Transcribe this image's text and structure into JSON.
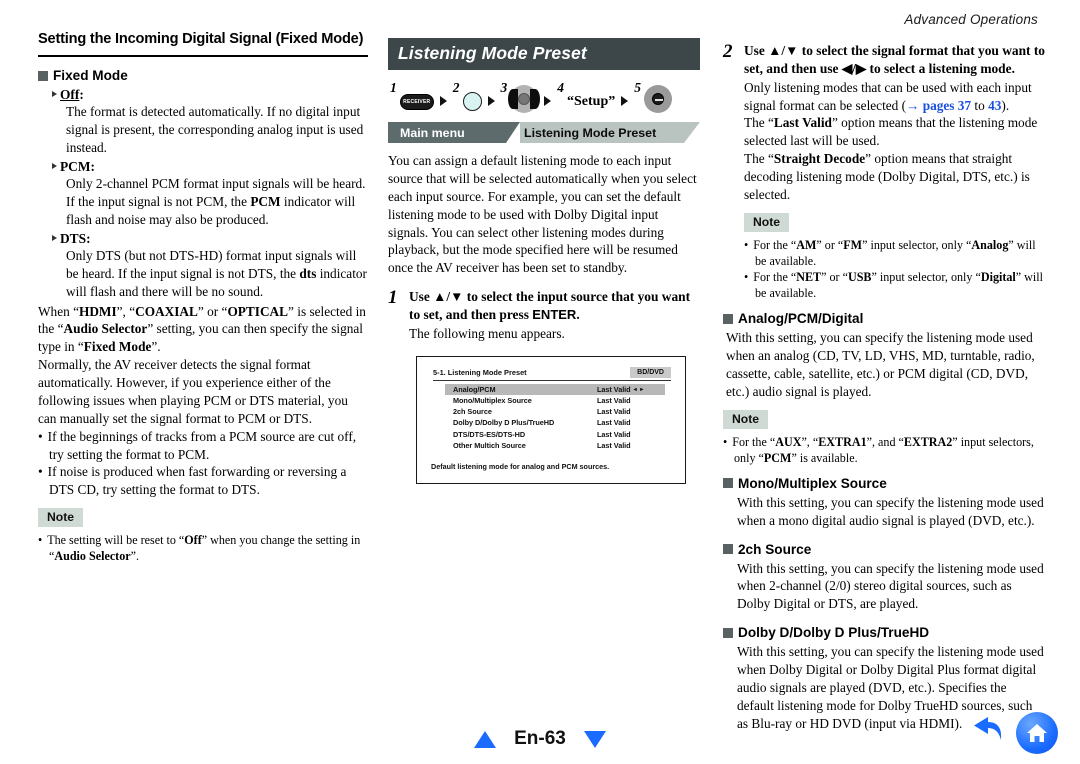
{
  "runhead": "Advanced Operations",
  "left": {
    "title": "Setting the Incoming Digital Signal (Fixed Mode)",
    "section_head": "Fixed Mode",
    "items": [
      {
        "term": "Off",
        "body": "The format is detected automatically. If no digital input signal is present, the corresponding analog input is used instead."
      },
      {
        "term": "PCM",
        "body_1": "Only 2-channel PCM format input signals will be heard. If the input signal is not PCM, the ",
        "body_bold": "PCM",
        "body_2": " indicator will flash and noise may also be produced."
      },
      {
        "term": "DTS",
        "body_1": "Only DTS (but not DTS-HD) format input signals will be heard. If the input signal is not DTS, the ",
        "body_bold": "dts",
        "body_2": " indicator will flash and there will be no sound."
      }
    ],
    "para_hdmi": {
      "p1": "When “",
      "b1": "HDMI",
      "p2": "”, “",
      "b2": "COAXIAL",
      "p3": "” or “",
      "b3": "OPTICAL",
      "p4": "” is selected in the “",
      "b4": "Audio Selector",
      "p5": "” setting, you can then specify the signal type in “",
      "b5": "Fixed Mode",
      "p6": "”."
    },
    "para_normally": "Normally, the AV receiver detects the signal format automatically. However, if you experience either of the following issues when playing PCM or DTS material, you can manually set the signal format to PCM or DTS.",
    "bullets": [
      "If the beginnings of tracks from a PCM source are cut off, try setting the format to PCM.",
      "If noise is produced when fast forwarding or reversing a DTS CD, try setting the format to DTS."
    ],
    "note_label": "Note",
    "note_bullet": {
      "p1": "The setting will be reset to “",
      "b1": "Off",
      "p2": "” when you change the setting in “",
      "b2": "Audio Selector",
      "p3": "”."
    }
  },
  "middle": {
    "title": "Listening Mode Preset",
    "steps": [
      {
        "num": "1",
        "icon": "receiver-button-icon",
        "label": "RECEIVER"
      },
      {
        "num": "2",
        "icon": "round-button-icon",
        "label": ""
      },
      {
        "num": "3",
        "icon": "dpad-left-right-icon",
        "label": ""
      },
      {
        "num": "4",
        "icon": "setup-word",
        "label": "“Setup”"
      },
      {
        "num": "5",
        "icon": "dpad-enter-icon",
        "label": ""
      }
    ],
    "breadcrumb": {
      "main": "Main menu",
      "sub": "Listening Mode Preset"
    },
    "intro": "You can assign a default listening mode to each input source that will be selected automatically when you select each input source. For example, you can set the default listening mode to be used with Dolby Digital input signals. You can select other listening modes during playback, but the mode specified here will be resumed once the AV receiver has been set to standby.",
    "step1": {
      "num": "1",
      "lead_1": "Use ▲/▼ to select the input source that you want to set, and then press ",
      "lead_enter": "ENTER",
      "lead_2": ".",
      "after": "The following menu appears."
    },
    "osd": {
      "title": "5-1. Listening Mode Preset",
      "badge": "BD/DVD",
      "rows": [
        {
          "label": "Analog/PCM",
          "value": "Last Valid",
          "arrows": "◂ ▸",
          "selected": true
        },
        {
          "label": "Mono/Multiplex Source",
          "value": "Last Valid",
          "arrows": "",
          "selected": false
        },
        {
          "label": "2ch Source",
          "value": "Last Valid",
          "arrows": "",
          "selected": false
        },
        {
          "label": "Dolby D/Dolby D Plus/TrueHD",
          "value": "Last Valid",
          "arrows": "",
          "selected": false
        },
        {
          "label": "DTS/DTS-ES/DTS-HD",
          "value": "Last Valid",
          "arrows": "",
          "selected": false
        },
        {
          "label": "Other Multich Source",
          "value": "Last Valid",
          "arrows": "",
          "selected": false
        }
      ],
      "footer": "Default listening mode for analog and PCM sources."
    }
  },
  "right": {
    "step2": {
      "num": "2",
      "lead": "Use ▲/▼ to select the signal format that you want to set, and then use ◀/▶ to select a listening mode.",
      "p1_a": "Only listening modes that can be used with each input signal format can be selected (",
      "p1_arrow": "→",
      "p1_link1": "pages 37",
      "p1_mid": " to ",
      "p1_link2": "43",
      "p1_b": ").",
      "p2_a": "The “",
      "p2_b": "Last Valid",
      "p2_c": "” option means that the listening mode selected last will be used.",
      "p3_a": "The “",
      "p3_b": "Straight Decode",
      "p3_c": "” option means that straight decoding listening mode (Dolby Digital, DTS, etc.) is selected."
    },
    "note1_label": "Note",
    "note1_bullets": [
      {
        "p1": "For the “",
        "b1": "AM",
        "p2": "” or “",
        "b2": "FM",
        "p3": "” input selector, only “",
        "b3": "Analog",
        "p4": "” will be available."
      },
      {
        "p1": "For the “",
        "b1": "NET",
        "p2": "” or “",
        "b2": "USB",
        "p3": "” input selector, only “",
        "b3": "Digital",
        "p4": "” will be available."
      }
    ],
    "sections": [
      {
        "head": "Analog/PCM/Digital",
        "body": "With this setting, you can specify the listening mode used when an analog (CD, TV, LD, VHS, MD, turntable, radio, cassette, cable, satellite, etc.) or PCM digital (CD, DVD, etc.) audio signal is played."
      },
      {
        "head": "Mono/Multiplex Source",
        "body": "With this setting, you can specify the listening mode used when a mono digital audio signal is played (DVD, etc.)."
      },
      {
        "head": "2ch Source",
        "body": "With this setting, you can specify the listening mode used when 2-channel (2/0) stereo digital sources, such as Dolby Digital or DTS, are played."
      },
      {
        "head": "Dolby D/Dolby D Plus/TrueHD",
        "body": "With this setting, you can specify the listening mode used when Dolby Digital or Dolby Digital Plus format digital audio signals are played (DVD, etc.). Specifies the default listening mode for Dolby TrueHD sources, such as Blu-ray or HD DVD (input via HDMI)."
      }
    ],
    "note2_label": "Note",
    "note2_bullet": {
      "p1": "For the “",
      "b1": "AUX",
      "p2": "”, “",
      "b2": "EXTRA1",
      "p3": "”, and “",
      "b3": "EXTRA2",
      "p4": "” input selectors, only “",
      "b4": "PCM",
      "p5": "” is available."
    }
  },
  "footer": {
    "page": "En-63",
    "up_icon": "triangle-up-icon",
    "down_icon": "triangle-down-icon",
    "back_icon": "back-arrow-icon",
    "home_icon": "home-icon"
  },
  "colors": {
    "accent_blue": "#1a6bff",
    "link_blue": "#1a4fe0",
    "title_bar": "#3d4749",
    "breadcrumb_main": "#5d6b6d",
    "breadcrumb_sub": "#b9c4c1",
    "note_bg": "#cfdad4",
    "square_bullet": "#5a6163"
  }
}
